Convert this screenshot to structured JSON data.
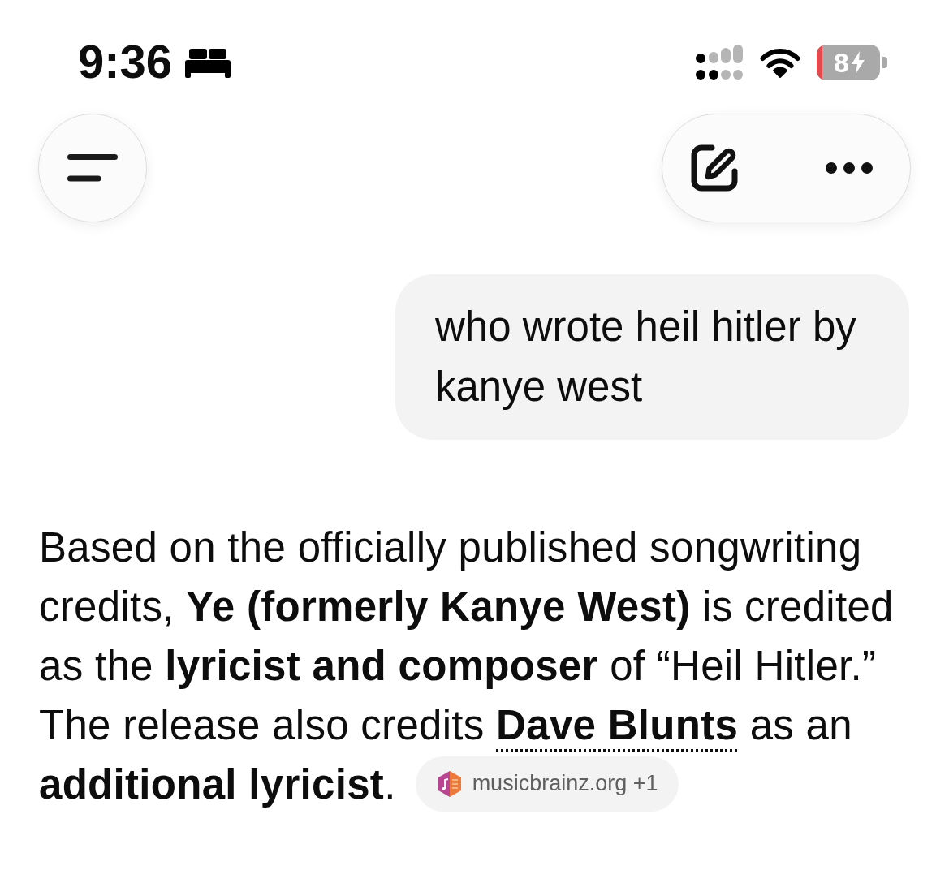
{
  "status_bar": {
    "time": "9:36",
    "battery_text": "8"
  },
  "conversation": [
    {
      "kind": "user_message",
      "text": "who wrote heil hitler by kanye west"
    },
    {
      "kind": "assistant_message",
      "segments": [
        {
          "kind": "text",
          "text": "Based on the officially published songwriting credits, **Ye (formerly Kanye West)** is credited as the **lyricist and composer** of “Heil Hitler.” The release also credits "
        },
        {
          "kind": "link",
          "text": "Dave Blunts"
        },
        {
          "kind": "text",
          "text": " as an **additional lyricist**."
        }
      ],
      "sources": {
        "label": "musicbrainz.org +1"
      }
    }
  ]
}
